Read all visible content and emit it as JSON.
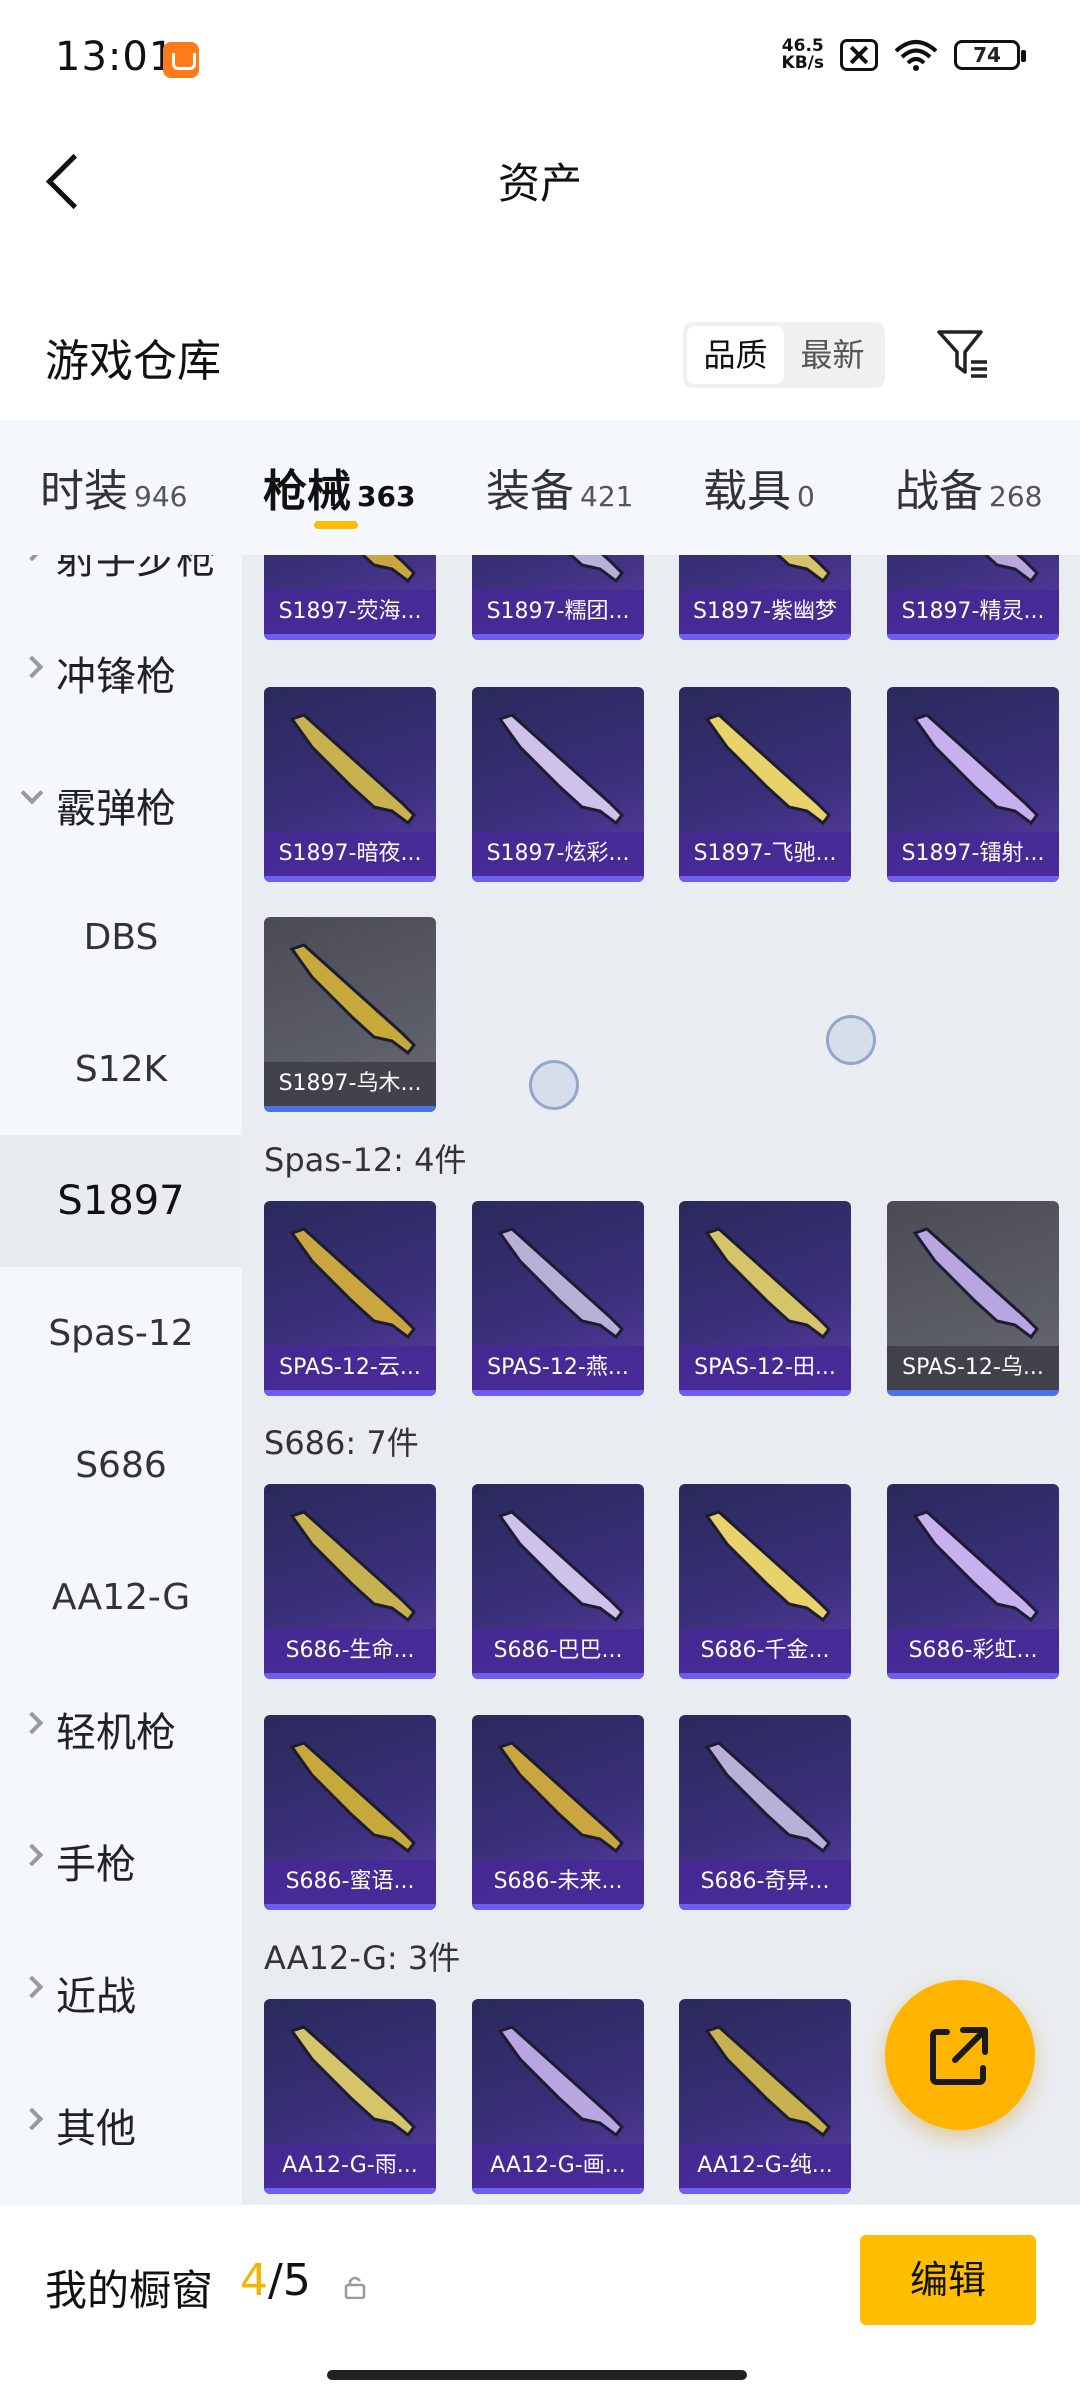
{
  "status_bar": {
    "time": "13:01",
    "net_speed_value": "46.5",
    "net_speed_unit": "KB/s",
    "battery": "74"
  },
  "header": {
    "title": "资产",
    "back_icon": "chevron-left-icon"
  },
  "section": {
    "title": "游戏仓库",
    "sort_options": [
      "品质",
      "最新"
    ],
    "sort_selected": "品质",
    "filter_icon": "filter-icon"
  },
  "category_tabs": [
    {
      "label": "时装",
      "count": "946"
    },
    {
      "label": "枪械",
      "count": "363"
    },
    {
      "label": "装备",
      "count": "421"
    },
    {
      "label": "载具",
      "count": "0"
    },
    {
      "label": "战备",
      "count": "268"
    }
  ],
  "active_tab": "枪械",
  "sidebar": {
    "items": [
      {
        "label": "射手步枪",
        "type": "group"
      },
      {
        "label": "冲锋枪",
        "type": "group"
      },
      {
        "label": "霰弹枪",
        "type": "group",
        "expanded": true
      },
      {
        "label": "DBS",
        "type": "sub"
      },
      {
        "label": "S12K",
        "type": "sub"
      },
      {
        "label": "S1897",
        "type": "sub",
        "selected": true
      },
      {
        "label": "Spas-12",
        "type": "sub"
      },
      {
        "label": "S686",
        "type": "sub"
      },
      {
        "label": "AA12-G",
        "type": "sub"
      },
      {
        "label": "轻机枪",
        "type": "group"
      },
      {
        "label": "手枪",
        "type": "group"
      },
      {
        "label": "近战",
        "type": "group"
      },
      {
        "label": "其他",
        "type": "group"
      }
    ]
  },
  "groups": [
    {
      "title": "",
      "items": [
        {
          "name": "S1897-荧海...",
          "quality": "purple"
        },
        {
          "name": "S1897-糯团...",
          "quality": "purple"
        },
        {
          "name": "S1897-紫幽梦",
          "quality": "purple"
        },
        {
          "name": "S1897-精灵...",
          "quality": "purple"
        },
        {
          "name": "S1897-暗夜...",
          "quality": "purple"
        },
        {
          "name": "S1897-炫彩...",
          "quality": "purple"
        },
        {
          "name": "S1897-飞驰...",
          "quality": "purple"
        },
        {
          "name": "S1897-镭射...",
          "quality": "purple"
        },
        {
          "name": "S1897-乌木...",
          "quality": "grey"
        }
      ]
    },
    {
      "title": "Spas-12: 4件",
      "items": [
        {
          "name": "SPAS-12-云...",
          "quality": "purple"
        },
        {
          "name": "SPAS-12-燕...",
          "quality": "purple"
        },
        {
          "name": "SPAS-12-田...",
          "quality": "purple"
        },
        {
          "name": "SPAS-12-乌...",
          "quality": "grey"
        }
      ]
    },
    {
      "title": "S686: 7件",
      "items": [
        {
          "name": "S686-生命...",
          "quality": "purple"
        },
        {
          "name": "S686-巴巴...",
          "quality": "purple"
        },
        {
          "name": "S686-千金...",
          "quality": "purple"
        },
        {
          "name": "S686-彩虹...",
          "quality": "purple"
        },
        {
          "name": "S686-蜜语...",
          "quality": "purple"
        },
        {
          "name": "S686-未来...",
          "quality": "purple"
        },
        {
          "name": "S686-奇异...",
          "quality": "purple"
        }
      ]
    },
    {
      "title": "AA12-G: 3件",
      "items": [
        {
          "name": "AA12-G-雨...",
          "quality": "purple"
        },
        {
          "name": "AA12-G-画...",
          "quality": "purple"
        },
        {
          "name": "AA12-G-纯...",
          "quality": "purple"
        }
      ]
    }
  ],
  "fab": {
    "icon": "share-export-icon"
  },
  "bottom_bar": {
    "label": "我的橱窗",
    "current": "4",
    "separator": "/",
    "total": "5",
    "lock_icon": "lock-icon",
    "edit_label": "编辑"
  },
  "colors": {
    "accent": "#ffbe00",
    "card_purple": "#3a2f7a",
    "card_grey": "#5a5c66"
  }
}
